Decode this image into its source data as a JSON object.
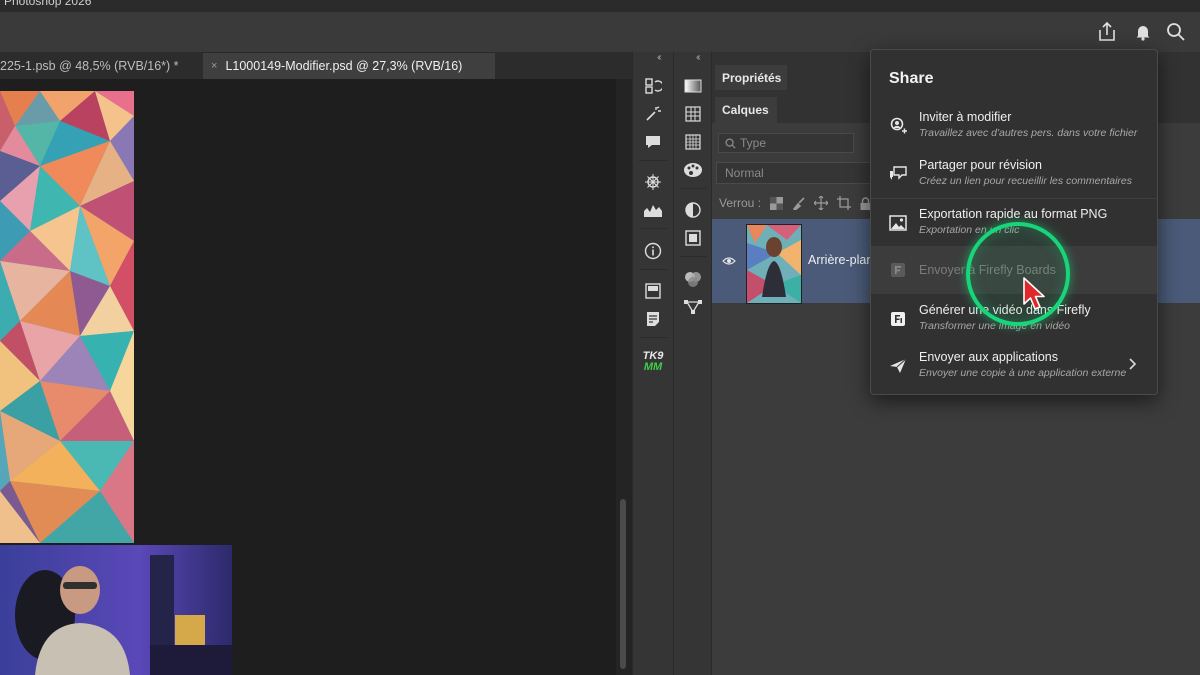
{
  "window": {
    "title": "Photoshop 2026"
  },
  "appbar": {
    "icons": [
      "share-icon",
      "bell-icon",
      "search-icon"
    ]
  },
  "doc_tabs": [
    {
      "label": "225-1.psb @ 48,5% (RVB/16*) *",
      "active": false
    },
    {
      "label": "L1000149-Modifier.psd @ 27,3% (RVB/16)",
      "active": true,
      "close": "×"
    }
  ],
  "toolstrip": {
    "collapse": "‹‹",
    "tk_badge_top": "TK9",
    "tk_badge_bottom": "MM"
  },
  "panels": {
    "tabs": {
      "properties": "Propriétés",
      "layers": "Calques"
    },
    "type_filter_placeholder": "Type",
    "blend_mode": "Normal",
    "lock_label": "Verrou :",
    "layer": {
      "name": "Arrière-plan",
      "visible": true
    }
  },
  "share_panel": {
    "title": "Share",
    "items": [
      {
        "title": "Inviter à modifier",
        "subtitle": "Travaillez avec d'autres pers. dans votre fichier",
        "icon": "invite-user-icon",
        "enabled": true
      },
      {
        "title": "Partager pour révision",
        "subtitle": "Créez un lien pour recueillir les commentaires",
        "icon": "review-comment-icon",
        "enabled": true
      },
      {
        "title": "Exportation rapide au format PNG",
        "subtitle": "Exportation en un clic",
        "icon": "image-export-icon",
        "enabled": true
      },
      {
        "title": "Envoyer à Firefly Boards",
        "subtitle": "",
        "icon": "firefly-boards-icon",
        "enabled": false
      },
      {
        "title": "Générer une vidéo dans Firefly",
        "subtitle": "Transformer une image en vidéo",
        "icon": "firefly-icon",
        "enabled": true
      },
      {
        "title": "Envoyer aux applications",
        "subtitle": "Envoyer une copie à une application externe",
        "icon": "send-paperplane-icon",
        "enabled": true,
        "has_submenu": true
      }
    ]
  },
  "colors": {
    "accent_ring": "#17d67a",
    "cursor": "#e0282a",
    "selected_layer": "#4a5a78"
  }
}
